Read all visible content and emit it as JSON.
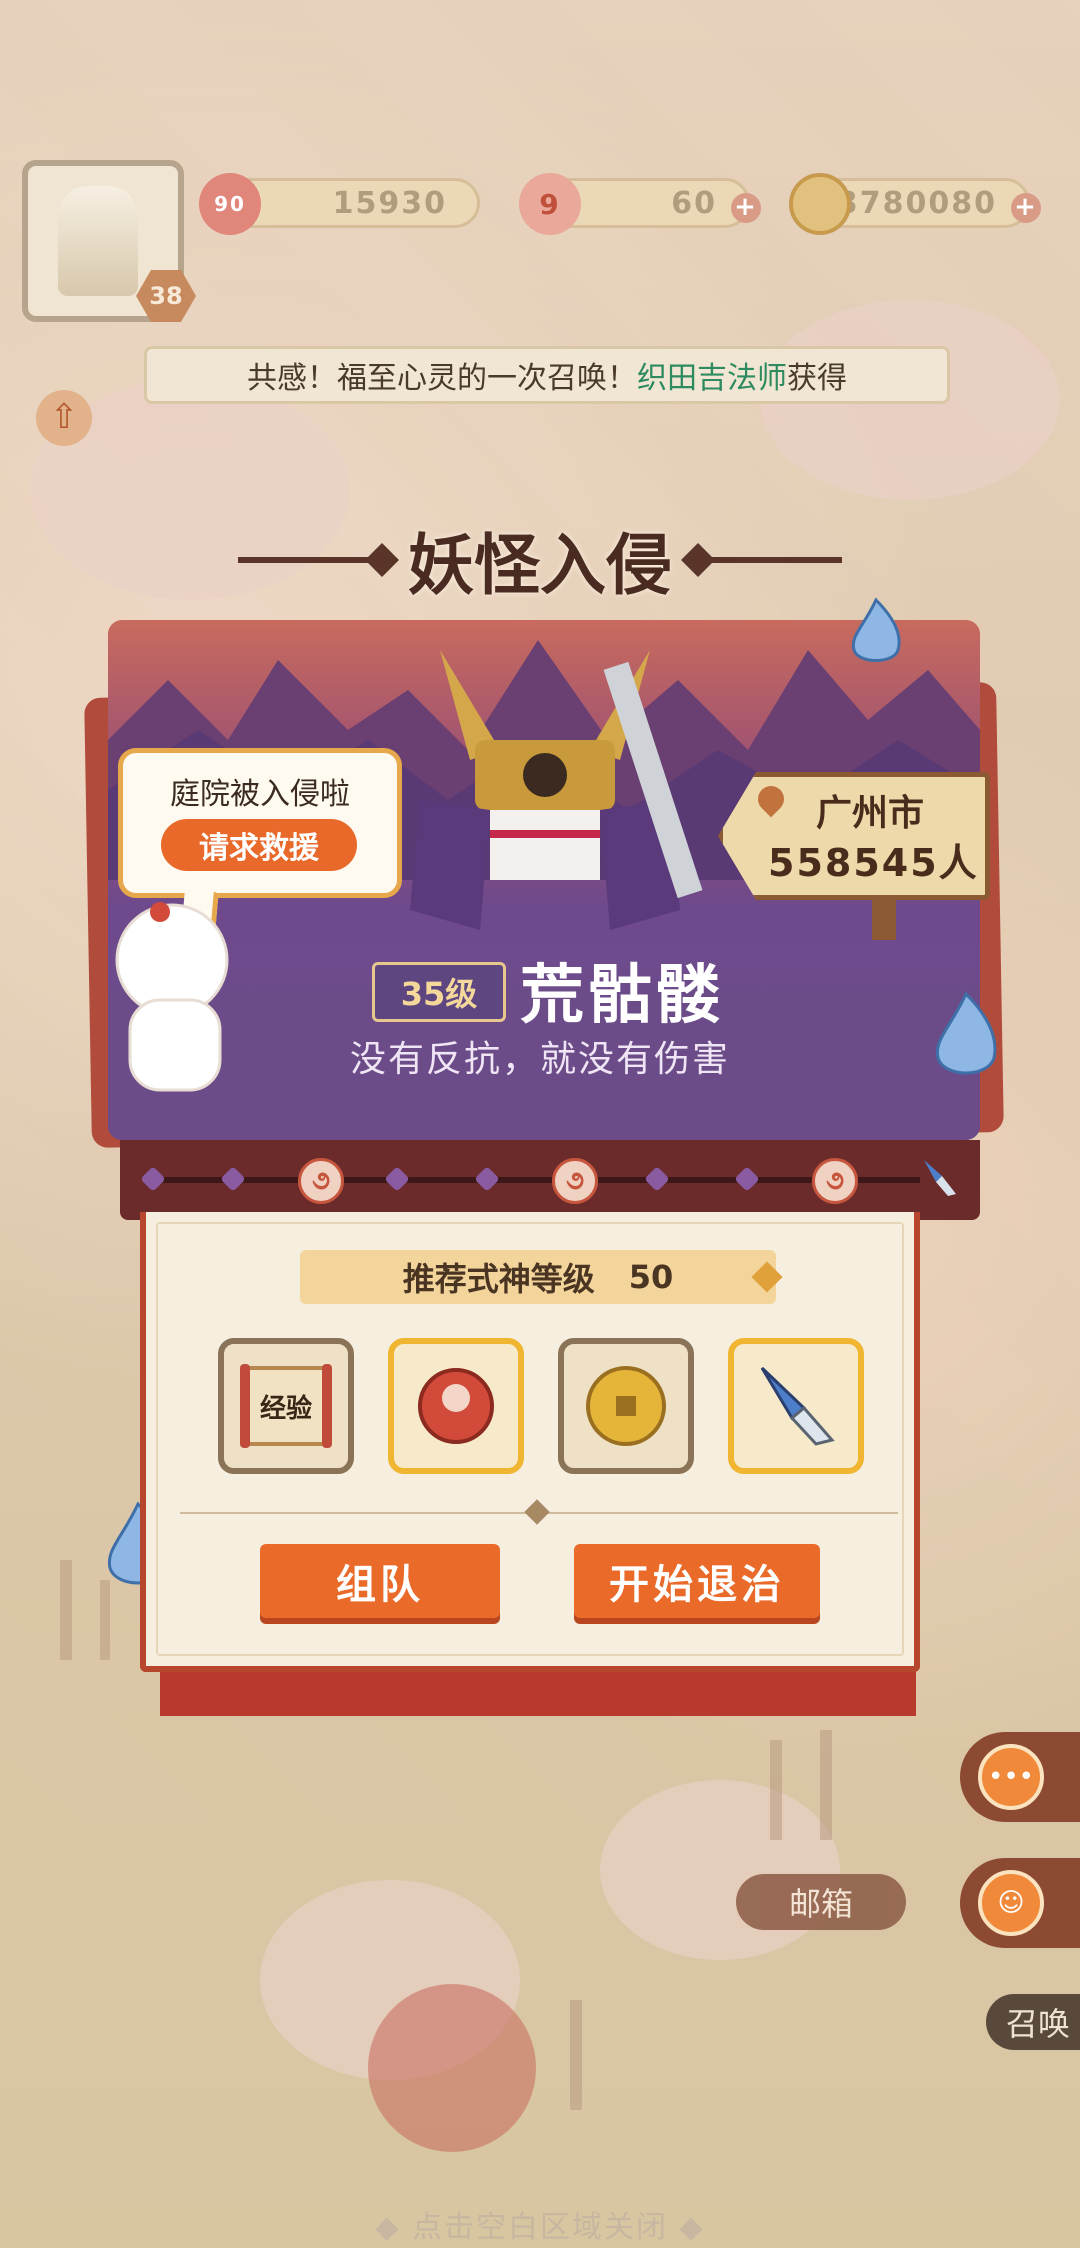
{
  "top_bar": {
    "player_level": "38",
    "resources": [
      {
        "name": "magatama-coin",
        "icon_label": "90",
        "value": "15930",
        "has_plus": false
      },
      {
        "name": "stamina",
        "icon_label": "9",
        "value": "60",
        "has_plus": true
      },
      {
        "name": "gold-coin",
        "icon_label": "",
        "value": "3780080",
        "has_plus": true
      }
    ]
  },
  "marquee": {
    "prefix": "共感！福至心灵的一次召唤！",
    "highlight": "织田吉法师",
    "suffix": "获得"
  },
  "event": {
    "title": "妖怪入侵",
    "boss_level": "35级",
    "boss_name": "荒骷髅",
    "boss_quote": "没有反抗，就没有伤害",
    "location_city": "广州市",
    "location_count": "558545人",
    "bubble_text": "庭院被入侵啦",
    "help_button": "请求救援"
  },
  "panel": {
    "recommend_label": "推荐式神等级",
    "recommend_value": "50",
    "rewards": [
      {
        "name": "exp-scroll",
        "label": "经验"
      },
      {
        "name": "stamina-token",
        "label": ""
      },
      {
        "name": "gold-coin",
        "label": ""
      },
      {
        "name": "tool-key",
        "label": ""
      }
    ],
    "team_button": "组队",
    "start_button": "开始退治"
  },
  "side": {
    "mail_label": "邮箱",
    "summon_label": "召唤"
  },
  "close_hint": "◆ 点击空白区域关闭 ◆",
  "colors": {
    "accent_orange": "#ea6a2a",
    "panel_red": "#b6472e",
    "banner_purple": "#6b4e8a",
    "highlight_green": "#2e8a5f"
  }
}
